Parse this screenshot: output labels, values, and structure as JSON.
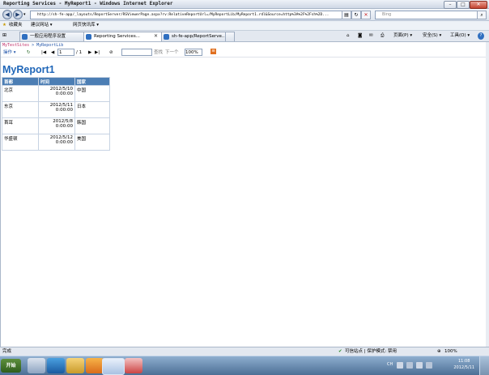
{
  "window": {
    "title": "Reporting Services - MyReport1 - Windows Internet Explorer",
    "min": "–",
    "max": "□",
    "close": "✕"
  },
  "address": {
    "url": "http://sh-fe-app/_layouts/ReportServer/RSViewerPage.aspx?rv:RelativeReportUrl=/MyReportLib/MyReport1.rdl&Source=http%3A%2F%2Fsh%2D...",
    "search_placeholder": "Bing"
  },
  "favorites": {
    "label": "收藏夹",
    "suggested": "建议网站 ▾",
    "gallery": "网页快讯库 ▾"
  },
  "tabs": [
    {
      "label": "一般应用程序设置"
    },
    {
      "label": "Reporting Services..."
    },
    {
      "label": "sh-fe-app/ReportServe..."
    }
  ],
  "commands": {
    "page": "页面(P) ▾",
    "safety": "安全(S) ▾",
    "tools": "工具(O) ▾",
    "help": "?"
  },
  "breadcrumb": {
    "site": "MyTestSites",
    "sep": " > ",
    "lib": "MyReportLib"
  },
  "toolbar": {
    "actions": "操作 ▾",
    "page_current": "1",
    "page_of": "/ 1",
    "find": "查找",
    "next": "下一个",
    "zoom": "100%"
  },
  "report": {
    "title": "MyReport1",
    "headers": [
      "首都",
      "时间",
      "国家"
    ],
    "rows": [
      {
        "capital": "北京",
        "time": "2012/5/10\n0:00:00",
        "country": "中国"
      },
      {
        "capital": "东京",
        "time": "2012/5/11\n0:00:00",
        "country": "日本"
      },
      {
        "capital": "首耳",
        "time": "2012/5/8\n0:00:00",
        "country": "韩国"
      },
      {
        "capital": "华盛顿",
        "time": "2012/5/12\n0:00:00",
        "country": "美国"
      }
    ]
  },
  "status": {
    "done": "完成",
    "zone": "可信站点 | 保护模式: 禁用",
    "zoom": "100%"
  },
  "taskbar": {
    "start": "开始",
    "lang": "CH",
    "time": "11:08",
    "date": "2012/5/11"
  }
}
